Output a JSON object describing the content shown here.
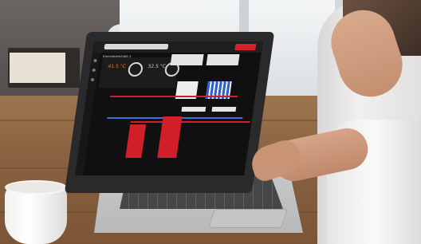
{
  "scene": {
    "description_role": "photo",
    "subject": "laptop-on-wooden-table"
  },
  "screen": {
    "title": "Energiezentrale 1",
    "temp_1": "41.5 °C",
    "temp_2": "32.5 °C",
    "accent_color": "#d11f2a",
    "background_color": "#101010"
  }
}
